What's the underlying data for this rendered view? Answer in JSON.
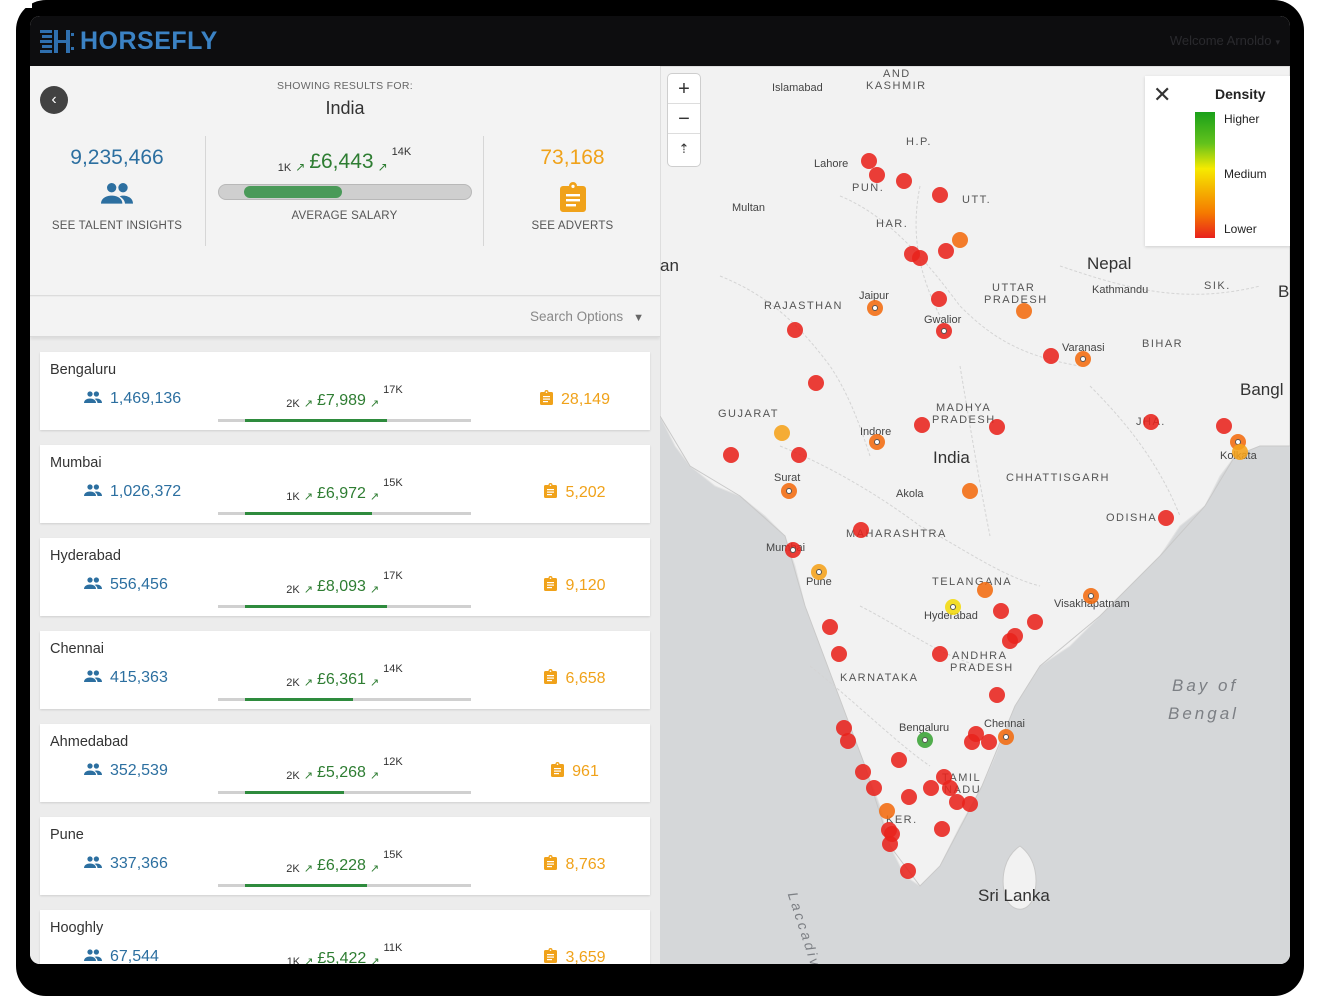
{
  "header": {
    "app_name": "HORSEFLY",
    "welcome": "Welcome Arnoldo"
  },
  "summary": {
    "showing_label": "SHOWING RESULTS FOR:",
    "country": "India",
    "talent_count": "9,235,466",
    "talent_label": "SEE TALENT INSIGHTS",
    "salary_low": "1K",
    "salary_value": "£6,443",
    "salary_high": "14K",
    "salary_position": 0.48,
    "salary_label": "AVERAGE SALARY",
    "adverts_count": "73,168",
    "adverts_label": "SEE ADVERTS"
  },
  "search_options": "Search Options",
  "locations": [
    {
      "name": "Bengaluru",
      "talent": "1,469,136",
      "low": "2K",
      "salary": "£7,989",
      "high": "17K",
      "position": 0.63,
      "adverts": "28,149"
    },
    {
      "name": "Mumbai",
      "talent": "1,026,372",
      "low": "1K",
      "salary": "£6,972",
      "high": "15K",
      "position": 0.56,
      "adverts": "5,202"
    },
    {
      "name": "Hyderabad",
      "talent": "556,456",
      "low": "2K",
      "salary": "£8,093",
      "high": "17K",
      "position": 0.63,
      "adverts": "9,120"
    },
    {
      "name": "Chennai",
      "talent": "415,363",
      "low": "2K",
      "salary": "£6,361",
      "high": "14K",
      "position": 0.48,
      "adverts": "6,658"
    },
    {
      "name": "Ahmedabad",
      "talent": "352,539",
      "low": "2K",
      "salary": "£5,268",
      "high": "12K",
      "position": 0.44,
      "adverts": "961"
    },
    {
      "name": "Pune",
      "talent": "337,366",
      "low": "2K",
      "salary": "£6,228",
      "high": "15K",
      "position": 0.54,
      "adverts": "8,763"
    },
    {
      "name": "Hooghly",
      "talent": "67,544",
      "low": "1K",
      "salary": "£5,422",
      "high": "11K",
      "position": 0.45,
      "adverts": "3,659"
    }
  ],
  "map": {
    "zoom_in": "+",
    "zoom_out": "−",
    "compass": "⇡",
    "legend": {
      "title": "Density",
      "higher": "Higher",
      "medium": "Medium",
      "lower": "Lower"
    },
    "labels": {
      "kashmir_1": "AND",
      "kashmir_2": "KASHMIR",
      "islamabad": "Islamabad",
      "hp": "H.P.",
      "lahore": "Lahore",
      "pun": "PUN.",
      "multan": "Multan",
      "utt": "UTT.",
      "har": "HAR.",
      "nepal": "Nepal",
      "kathmandu": "Kathmandu",
      "sik": "SIK.",
      "bh": "Bh",
      "an": "an",
      "rajasthan": "RAJASTHAN",
      "jaipur": "Jaipur",
      "up_1": "UTTAR",
      "up_2": "PRADESH",
      "gwalior": "Gwalior",
      "varanasi": "Varanasi",
      "bihar": "BIHAR",
      "bangl": "Bangl",
      "gujarat": "GUJARAT",
      "mp_1": "MADHYA",
      "mp_2": "PRADESH",
      "indore": "Indore",
      "jha": "JHA.",
      "kolkata": "Kolkata",
      "india": "India",
      "chhattisgarh": "CHHATTISGARH",
      "surat": "Surat",
      "akola": "Akola",
      "odisha": "ODISHA",
      "maharashtra": "MAHARASHTRA",
      "mumbai": "Mumbai",
      "pune": "Pune",
      "telangana": "TELANGANA",
      "hyderabad": "Hyderabad",
      "visakhapatnam": "Visakhapatnam",
      "ap_1": "ANDHRA",
      "ap_2": "PRADESH",
      "karnataka": "KARNATAKA",
      "bay_1": "Bay of",
      "bay_2": "Bengal",
      "bengaluru": "Bengaluru",
      "chennai": "Chennai",
      "tamil": "TAMIL",
      "nadu": "NADU",
      "ker": "KER.",
      "laccadive": "Laccadive Sea",
      "srilanka": "Sri Lanka"
    },
    "colors": {
      "red": "#e8231d",
      "orange": "#f36b0f",
      "amber": "#f5a21a",
      "yellow": "#f2d90c",
      "green": "#3aa335"
    }
  }
}
